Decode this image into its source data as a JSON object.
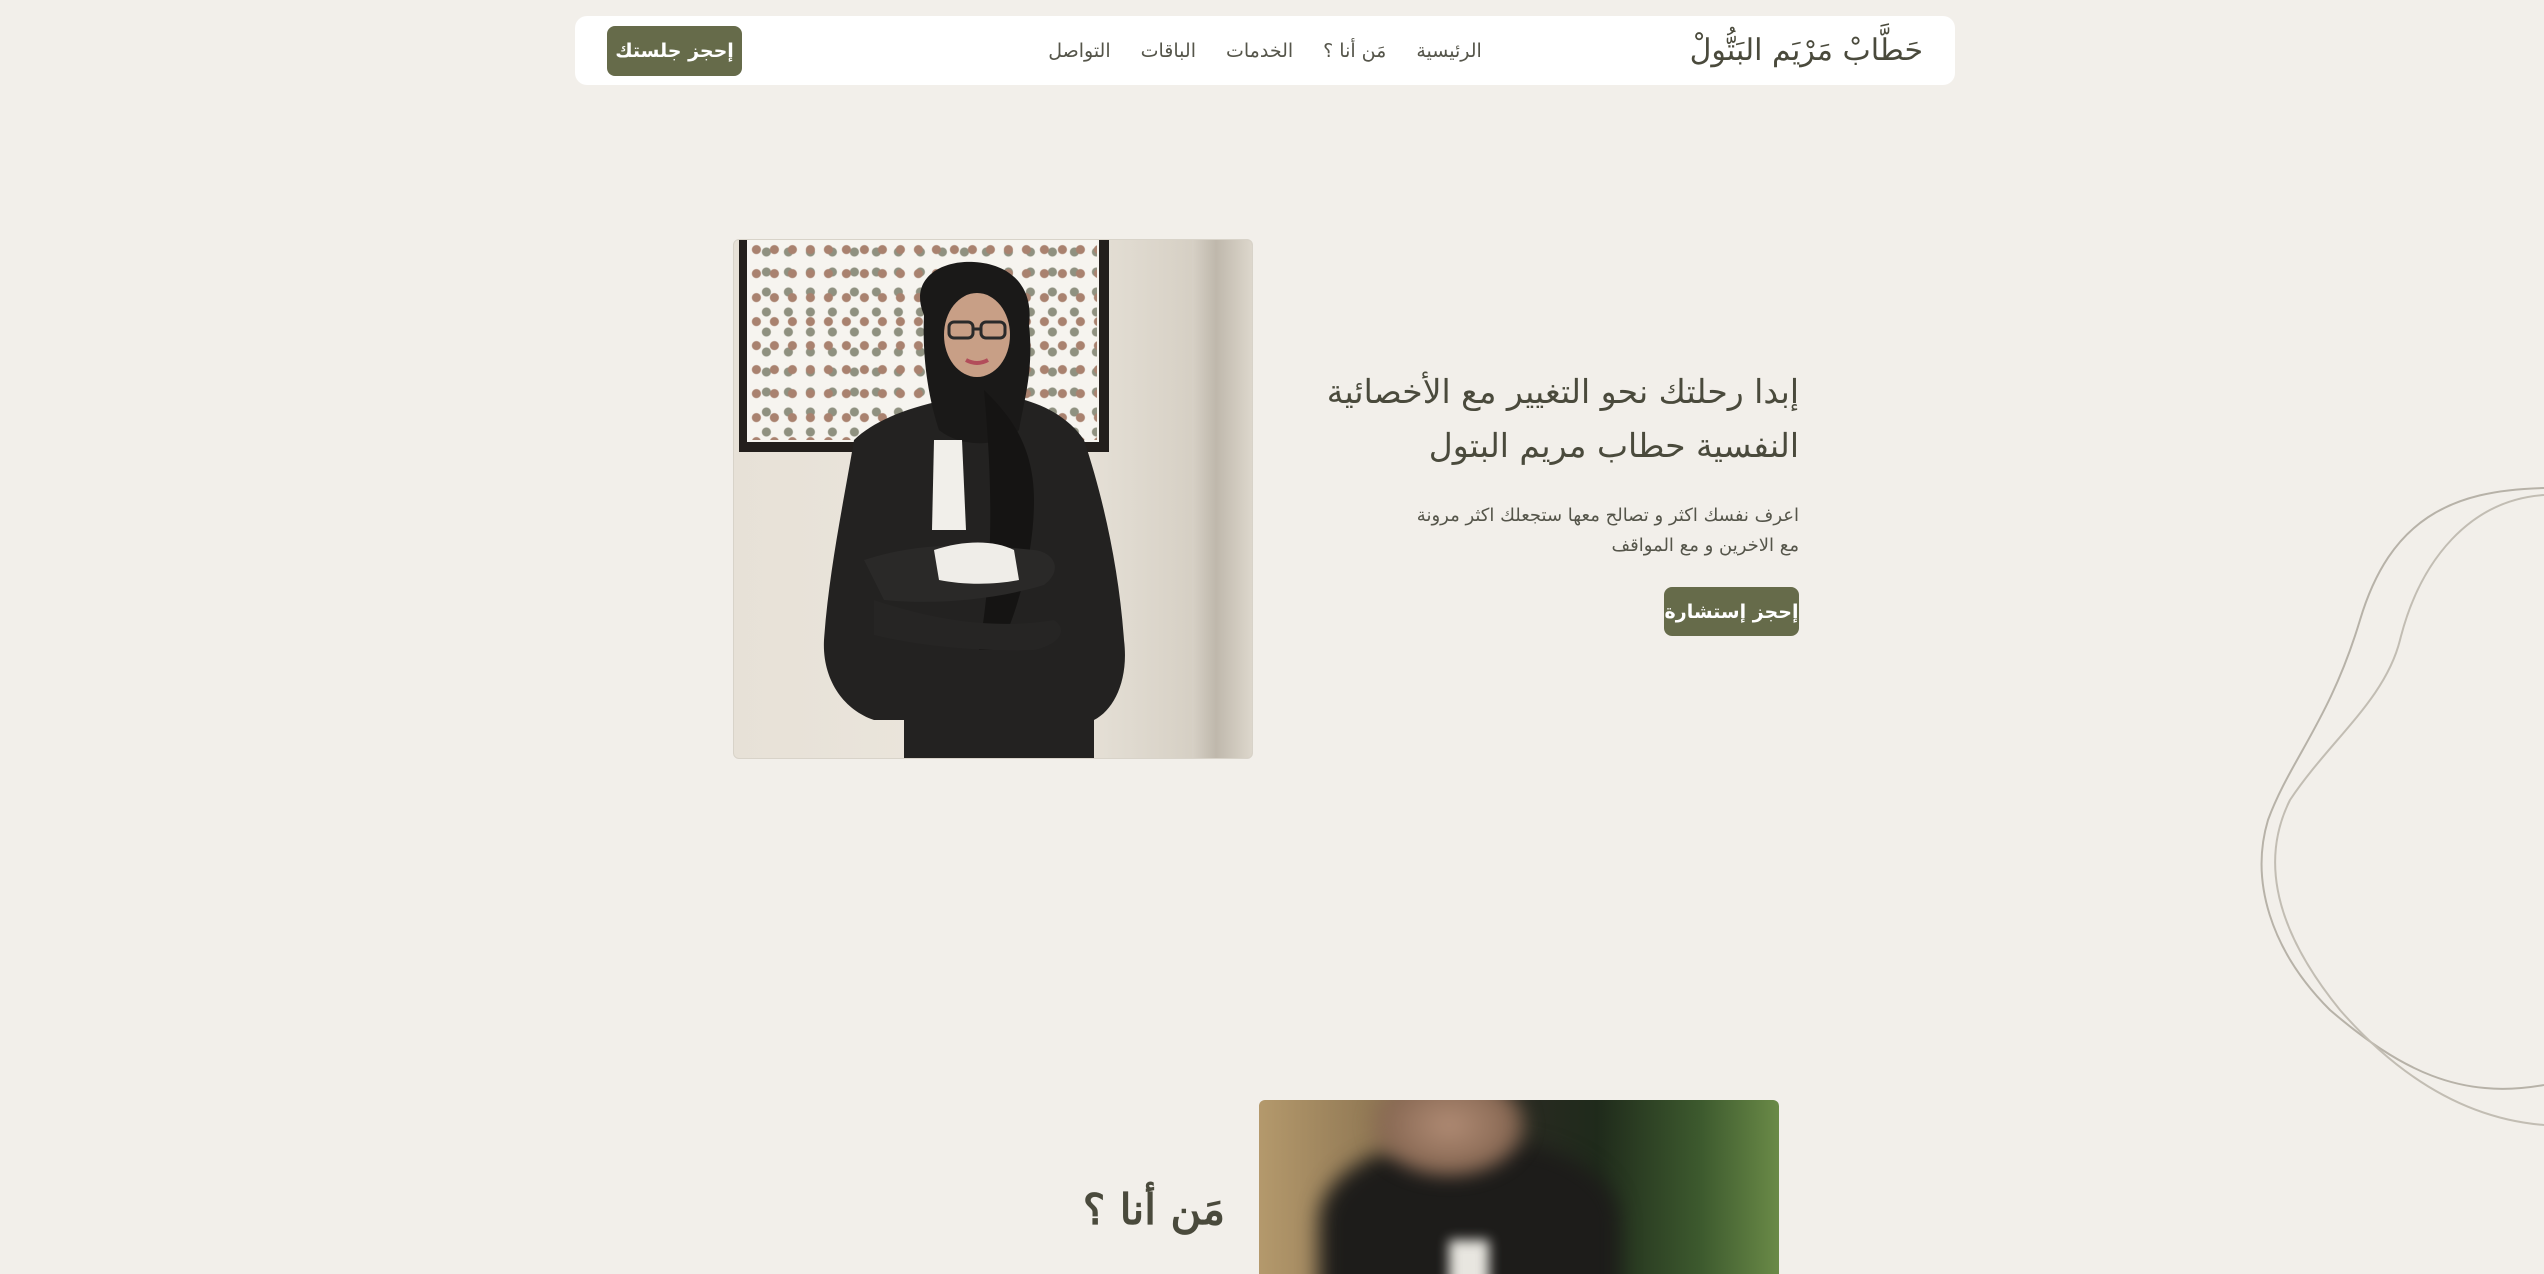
{
  "header": {
    "brand": "حَطَّابْ مَرْيَم البَتُّولْ",
    "nav": [
      {
        "label": "الرئيسية"
      },
      {
        "label": "مَن أنا ؟"
      },
      {
        "label": "الخدمات"
      },
      {
        "label": "الباقات"
      },
      {
        "label": "التواصل"
      }
    ],
    "cta_label": "إحجز جلستك"
  },
  "hero": {
    "title_line1": "إبدا رحلتك نحو التغيير مع الأخصائية",
    "title_line2": "النفسية حطاب مريم البتول",
    "subtitle_line1": "اعرف نفسك اكثر و تصالح معها ستجعلك اكثر مرونة",
    "subtitle_line2": "مع الاخرين و مع المواقف",
    "cta_label": "إحجز إستشارة"
  },
  "about": {
    "title": "مَن أنا ؟"
  },
  "colors": {
    "background": "#f2efea",
    "accent": "#666b4a",
    "text": "#4a4a3c"
  }
}
